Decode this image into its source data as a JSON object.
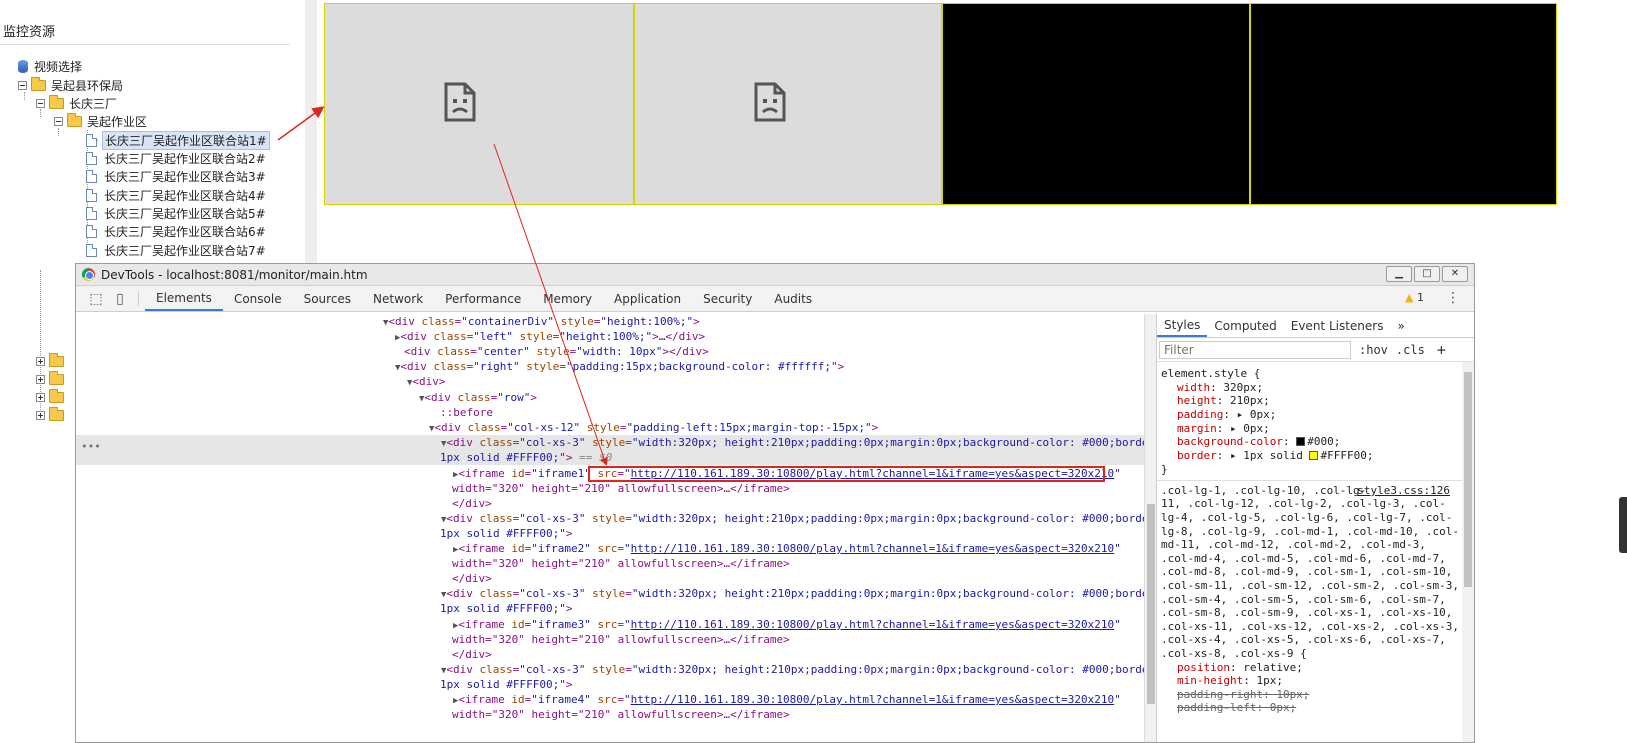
{
  "tree": {
    "title": "监控资源",
    "nodes": [
      {
        "label": "视频选择",
        "icon": "db-icon"
      },
      {
        "label": "吴起县环保局",
        "icon": "folder-icon"
      },
      {
        "label": "长庆三厂",
        "icon": "folder-icon"
      },
      {
        "label": "吴起作业区",
        "icon": "folder-icon"
      },
      {
        "label": "长庆三厂吴起作业区联合站1#",
        "icon": "file-icon",
        "selected": true
      },
      {
        "label": "长庆三厂吴起作业区联合站2#",
        "icon": "file-icon"
      },
      {
        "label": "长庆三厂吴起作业区联合站3#",
        "icon": "file-icon"
      },
      {
        "label": "长庆三厂吴起作业区联合站4#",
        "icon": "file-icon"
      },
      {
        "label": "长庆三厂吴起作业区联合站5#",
        "icon": "file-icon"
      },
      {
        "label": "长庆三厂吴起作业区联合站6#",
        "icon": "file-icon"
      },
      {
        "label": "长庆三厂吴起作业区联合站7#",
        "icon": "file-icon"
      }
    ]
  },
  "video_grid": {
    "cells": [
      {
        "state": "broken",
        "icon": "sad-page-icon"
      },
      {
        "state": "broken",
        "icon": "sad-page-icon"
      },
      {
        "state": "black"
      },
      {
        "state": "black"
      }
    ],
    "colors": {
      "border": "#d7d400",
      "broken_bg": "#dcdcdc",
      "black_bg": "#000000"
    }
  },
  "devtools": {
    "title": "DevTools - localhost:8081/monitor/main.htm",
    "window_buttons": [
      "minimize-icon",
      "maximize-icon",
      "close-icon"
    ],
    "tabs": [
      "Elements",
      "Console",
      "Sources",
      "Network",
      "Performance",
      "Memory",
      "Application",
      "Security",
      "Audits"
    ],
    "active_tab": "Elements",
    "warning_count": "1",
    "elements": {
      "selected_suffix": "== $0",
      "selected_prefix": "•••",
      "iframe_url": "http://110.161.189.30:10800/play.html?channel=1&iframe=yes&aspect=320x210",
      "cell_style": "width:320px; height:210px;padding:0px;margin:0px;background-color: #000;border:",
      "cell_style_cont": "1px solid #FFFF00;",
      "iframe_ids": [
        "iframe1",
        "iframe2",
        "iframe3",
        "iframe4"
      ],
      "iframe_size_attrs": "width=\"320\" height=\"210\" allowfullscreen>…</iframe>",
      "close_div": "</div>",
      "container_style": "height:100%;",
      "left_style": "height:100%;",
      "center_style": "width: 10px",
      "right_style": "padding:15px;background-color: #ffffff;",
      "before_pseudo": "::before",
      "col12_style": "padding-left:15px;margin-top:-15px;"
    },
    "styles": {
      "tabs": [
        "Styles",
        "Computed",
        "Event Listeners"
      ],
      "more": "»",
      "filter_placeholder": "Filter",
      "hov": ":hov",
      "cls": ".cls",
      "add": "+",
      "element_style_selector": "element.style {",
      "element_style": [
        {
          "prop": "width",
          "value": "320px;"
        },
        {
          "prop": "height",
          "value": "210px;"
        },
        {
          "prop": "padding",
          "value": "▸ 0px;"
        },
        {
          "prop": "margin",
          "value": "▸ 0px;"
        },
        {
          "prop": "background-color",
          "value": "#000;",
          "swatch": "#000000"
        },
        {
          "prop": "border",
          "value": "▸ 1px solid ",
          "swatch": "#FFFF00",
          "value2": "#FFFF00;"
        }
      ],
      "close_brace": "}",
      "rule_source": "style3.css:126",
      "rule_selector_lines": [
        ".col-lg-1, .col-lg-10, .col-lg-",
        "11, .col-lg-12, .col-lg-2, .col-lg-3, .col-",
        "lg-4, .col-lg-5, .col-lg-6, .col-lg-7, .col-",
        "lg-8, .col-lg-9, .col-md-1, .col-md-10, .col-",
        "md-11, .col-md-12, .col-md-2, .col-md-3,",
        ".col-md-4, .col-md-5, .col-md-6, .col-md-7,",
        ".col-md-8, .col-md-9, .col-sm-1, .col-sm-10,",
        ".col-sm-11, .col-sm-12, .col-sm-2, .col-sm-3,",
        ".col-sm-4, .col-sm-5, .col-sm-6, .col-sm-7,",
        ".col-sm-8, .col-sm-9, .col-xs-1, .col-xs-10,",
        ".col-xs-11, .col-xs-12, .col-xs-2, .col-xs-3,",
        ".col-xs-4, .col-xs-5, .col-xs-6, .col-xs-7,",
        ".col-xs-8, .col-xs-9 {"
      ],
      "rule_props": [
        {
          "prop": "position",
          "value": "relative;",
          "struck": false
        },
        {
          "prop": "min-height",
          "value": "1px;",
          "struck": false
        },
        {
          "prop": "padding-right",
          "value": "10px;",
          "struck": true
        },
        {
          "prop": "padding-left",
          "value": "0px;",
          "struck": true
        }
      ]
    }
  },
  "annotations": {
    "arrow_color": "#e0251b",
    "highlight_color": "#e0251b"
  }
}
